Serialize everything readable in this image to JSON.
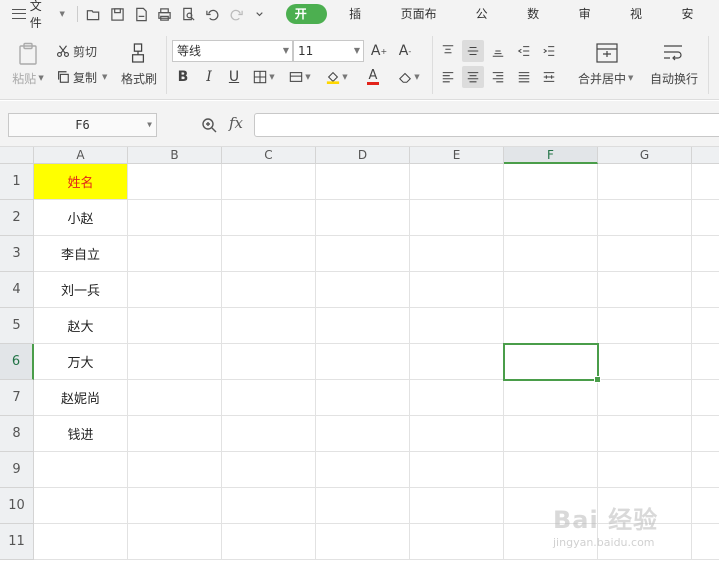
{
  "menubar": {
    "file_label": "文件",
    "tabs": [
      "开始",
      "插入",
      "页面布局",
      "公式",
      "数据",
      "审阅",
      "视图",
      "安全"
    ],
    "active_tab": "开始"
  },
  "ribbon": {
    "paste_label": "粘贴",
    "cut_label": "剪切",
    "copy_label": "复制",
    "format_painter_label": "格式刷",
    "font_name": "等线",
    "font_size": "11",
    "merge_label": "合并居中",
    "wrap_label": "自动换行",
    "font_color": "#e2231a",
    "fill_color": "#ffd700"
  },
  "formula_bar": {
    "name_box": "F6",
    "fx_label": "fx",
    "formula_value": ""
  },
  "sheet": {
    "columns": [
      "A",
      "B",
      "C",
      "D",
      "E",
      "F",
      "G"
    ],
    "rows": [
      "1",
      "2",
      "3",
      "4",
      "5",
      "6",
      "7",
      "8",
      "9",
      "10",
      "11"
    ],
    "column_a_values": [
      "姓名",
      "小赵",
      "李自立",
      "刘一兵",
      "赵大",
      "万大",
      "赵妮尚",
      "钱进",
      "",
      "",
      ""
    ],
    "selected_cell": "F6",
    "header_fill": "#ffff00",
    "header_text_color": "#e2231a",
    "selection_color": "#4a9d4a"
  },
  "watermark": {
    "brand": "Bai 经验",
    "url": "jingyan.baidu.com"
  }
}
